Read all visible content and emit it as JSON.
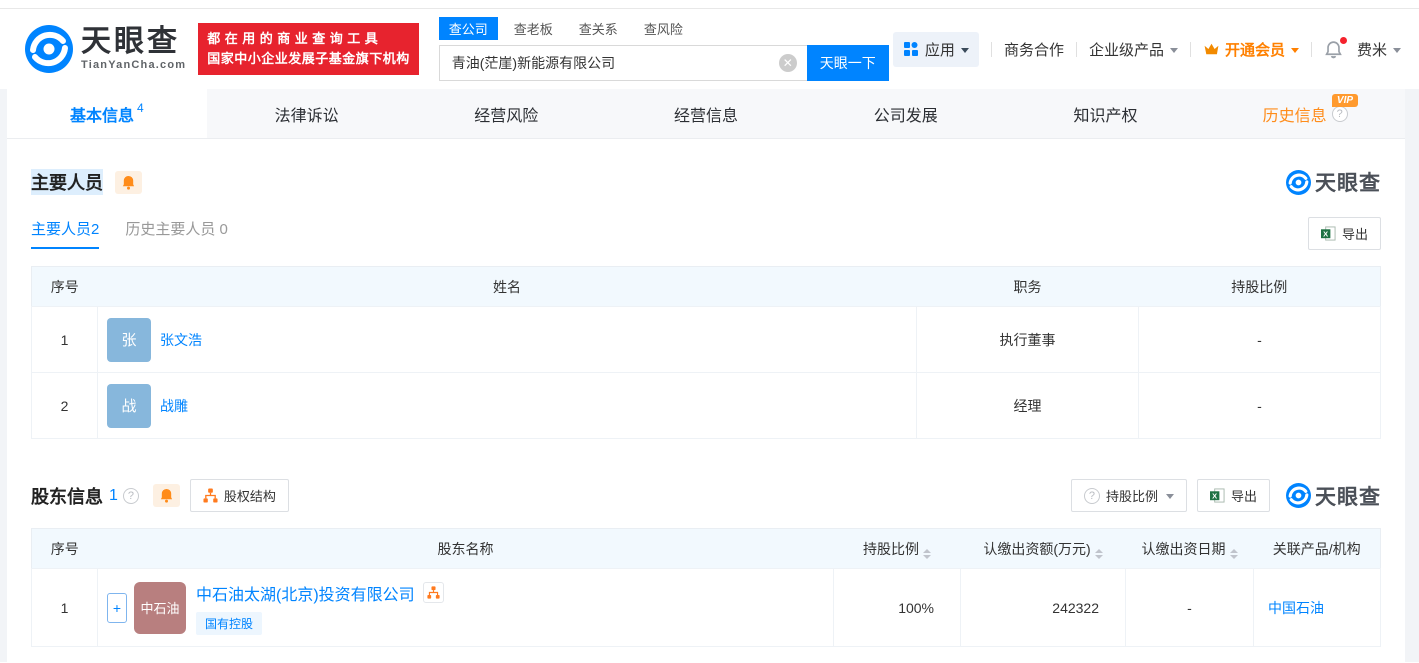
{
  "header": {
    "logo": {
      "title": "天眼查",
      "domain": "TianYanCha.com"
    },
    "slogan": {
      "line1": "都在用的商业查询工具",
      "line2": "国家中小企业发展子基金旗下机构"
    },
    "search": {
      "tabs": [
        {
          "label": "查公司"
        },
        {
          "label": "查老板"
        },
        {
          "label": "查关系"
        },
        {
          "label": "查风险"
        }
      ],
      "value": "青油(茫崖)新能源有限公司",
      "button": "天眼一下"
    },
    "nav": {
      "app": "应用",
      "cooperation": "商务合作",
      "enterprise": "企业级产品",
      "vip": "开通会员",
      "username": "费米"
    }
  },
  "main_tabs": [
    {
      "label": "基本信息",
      "badge": "4"
    },
    {
      "label": "法律诉讼"
    },
    {
      "label": "经营风险"
    },
    {
      "label": "经营信息"
    },
    {
      "label": "公司发展"
    },
    {
      "label": "知识产权"
    },
    {
      "label": "历史信息",
      "vip_badge": "VIP"
    }
  ],
  "members": {
    "title": "主要人员",
    "subtabs": [
      {
        "label": "主要人员",
        "count": "2"
      },
      {
        "label": "历史主要人员",
        "count": "0"
      }
    ],
    "export_label": "导出",
    "watermark": "天眼查",
    "table": {
      "col_no": "序号",
      "col_name": "姓名",
      "col_position": "职务",
      "col_ratio": "持股比例",
      "rows": [
        {
          "no": "1",
          "avatar": "张",
          "name": "张文浩",
          "position": "执行董事",
          "ratio": "-"
        },
        {
          "no": "2",
          "avatar": "战",
          "name": "战雕",
          "position": "经理",
          "ratio": "-"
        }
      ]
    }
  },
  "shareholders": {
    "title": "股东信息",
    "count": "1",
    "structure_button": "股权结构",
    "ratio_button": "持股比例",
    "export_label": "导出",
    "watermark": "天眼查",
    "table": {
      "col_no": "序号",
      "col_name": "股东名称",
      "col_ratio": "持股比例",
      "col_amount": "认缴出资额(万元)",
      "col_date": "认缴出资日期",
      "col_related": "关联产品/机构",
      "row": {
        "no": "1",
        "plus": "+",
        "avatar": "中石油",
        "name": "中石油太湖(北京)投资有限公司",
        "tag": "国有控股",
        "ratio": "100%",
        "amount": "242322",
        "date": "-",
        "related": "中国石油"
      }
    }
  },
  "colors": {
    "accent": "#0084ff",
    "orange": "#ff8000",
    "banner_red": "#e7232e",
    "avatar_blue": "#87b7dc",
    "avatar_brown": "#b87f7f",
    "history_tab": "#ff8c1a"
  }
}
